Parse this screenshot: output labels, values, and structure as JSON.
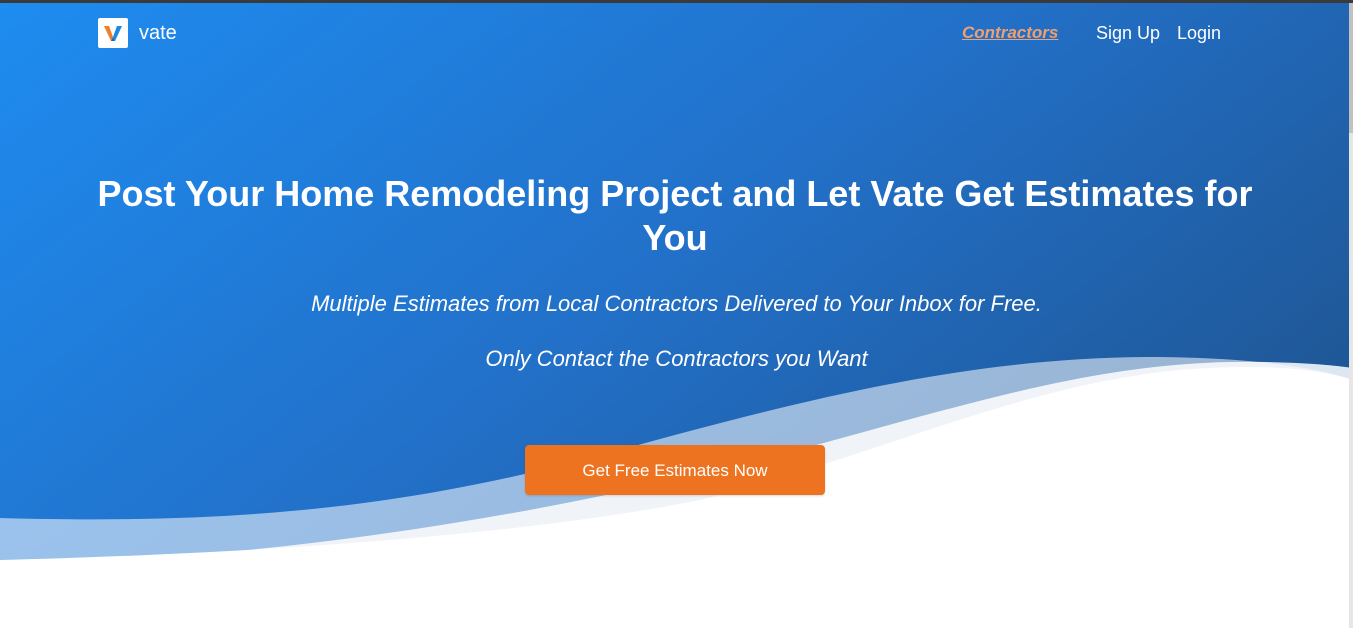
{
  "brand": {
    "name": "vate",
    "logo_icon": "vate-v-logo-icon",
    "logo_colors": {
      "left": "#f07f2c",
      "right": "#1e88e5"
    }
  },
  "nav": {
    "contractors_label": "Contractors",
    "signup_label": "Sign Up",
    "login_label": "Login"
  },
  "hero": {
    "title": "Post Your Home Remodeling Project and Let Vate Get Estimates for You",
    "subtitle_1": "Multiple Estimates from Local Contractors Delivered to Your Inbox for Free.",
    "subtitle_2": "Only Contact the Contractors you Want",
    "cta_label": "Get Free Estimates Now"
  },
  "colors": {
    "hero_gradient_start": "#1e8cf0",
    "hero_gradient_end": "#1f5796",
    "accent_orange": "#ee7320",
    "contractors_link": "#f0a070",
    "wave_light": "#dbe6f2"
  }
}
